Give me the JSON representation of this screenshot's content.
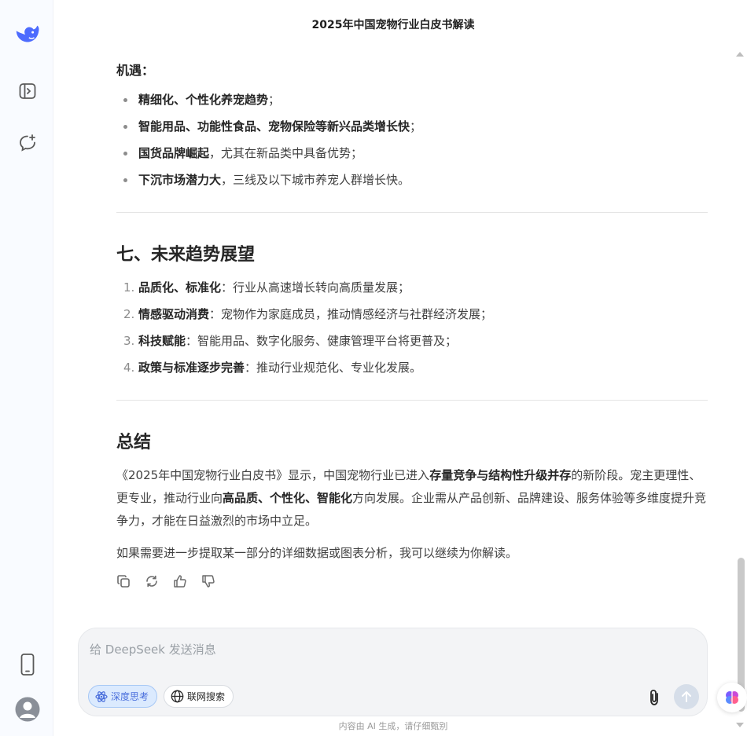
{
  "header": {
    "title": "2025年中国宠物行业白皮书解读"
  },
  "opportunities": {
    "heading": "机遇：",
    "items": [
      {
        "bold": "精细化、个性化养宠趋势",
        "rest": "；"
      },
      {
        "bold": "智能用品、功能性食品、宠物保险等新兴品类增长快",
        "rest": "；"
      },
      {
        "bold": "国货品牌崛起",
        "rest": "，尤其在新品类中具备优势；"
      },
      {
        "bold": "下沉市场潜力大",
        "rest": "，三线及以下城市养宠人群增长快。"
      }
    ]
  },
  "trends": {
    "heading": "七、未来趋势展望",
    "items": [
      {
        "num": "1.",
        "bold": "品质化、标准化",
        "rest": "：行业从高速增长转向高质量发展；"
      },
      {
        "num": "2.",
        "bold": "情感驱动消费",
        "rest": "：宠物作为家庭成员，推动情感经济与社群经济发展；"
      },
      {
        "num": "3.",
        "bold": "科技赋能",
        "rest": "：智能用品、数字化服务、健康管理平台将更普及；"
      },
      {
        "num": "4.",
        "bold": "政策与标准逐步完善",
        "rest": "：推动行业规范化、专业化发展。"
      }
    ]
  },
  "summary": {
    "heading": "总结",
    "p1_a": "《2025年中国宠物行业白皮书》显示，中国宠物行业已进入",
    "p1_b": "存量竞争与结构性升级并存",
    "p1_c": "的新阶段。宠主更理性、更专业，推动行业向",
    "p1_d": "高品质、个性化、智能化",
    "p1_e": "方向发展。企业需从产品创新、品牌建设、服务体验等多维度提升竞争力，才能在日益激烈的市场中立足。",
    "p2": "如果需要进一步提取某一部分的详细数据或图表分析，我可以继续为你解读。"
  },
  "composer": {
    "placeholder": "给 DeepSeek 发送消息",
    "deep_think_label": "深度思考",
    "web_search_label": "联网搜索"
  },
  "footer": {
    "note": "内容由 AI 生成，请仔细甄别"
  },
  "colors": {
    "brand": "#4d6bfe",
    "accent_chip": "#dbeafe"
  }
}
